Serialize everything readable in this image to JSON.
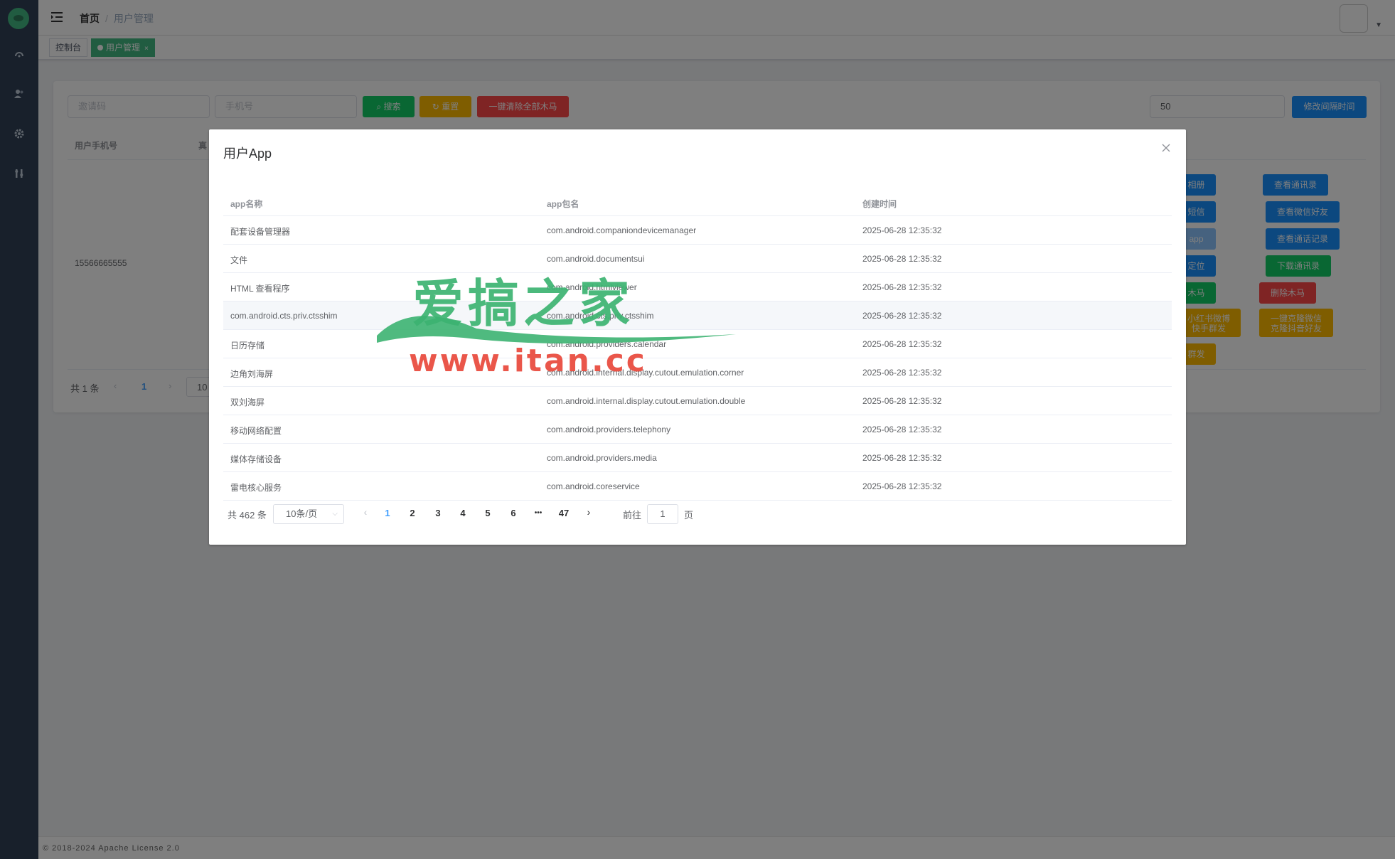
{
  "sidebar": {
    "icons": [
      "dashboard-icon",
      "users-icon",
      "gear-icon",
      "tools-icon"
    ]
  },
  "header": {
    "breadcrumb_home": "首页",
    "breadcrumb_separator": "/",
    "breadcrumb_current": "用户管理"
  },
  "tags": {
    "console": "控制台",
    "user_mgmt": "用户管理",
    "close": "×"
  },
  "filter": {
    "invite_placeholder": "邀请码",
    "phone_placeholder": "手机号",
    "search": "搜索",
    "reset": "重置",
    "clear_all": "一键清除全部木马",
    "interval_value": "50",
    "update_interval": "修改间隔时间"
  },
  "user_table": {
    "col_phone": "用户手机号",
    "col_name_partial": "真",
    "row_phone": "15566665555",
    "actions": {
      "album": "相册",
      "contacts": "查看通讯录",
      "sms": "短信",
      "wechat_friends": "查看微信好友",
      "app": "app",
      "call_log": "查看通话记录",
      "location": "定位",
      "download_contacts": "下载通讯录",
      "trojan": "木马",
      "delete_trojan": "删除木马",
      "xhs_line1": "小红书微博",
      "xhs_line2": "快手群发",
      "clone_line1": "一键克隆微信",
      "clone_line2": "克隆抖音好友",
      "mass": "群发"
    },
    "pager_total": "共 1 条",
    "pager_page": "1",
    "pager_size_partial": "10"
  },
  "dialog": {
    "title": "用户App",
    "close": "×",
    "columns": [
      "app名称",
      "app包名",
      "创建时间"
    ],
    "rows": [
      {
        "name": "配套设备管理器",
        "package": "com.android.companiondevicemanager",
        "time": "2025-06-28 12:35:32"
      },
      {
        "name": "文件",
        "package": "com.android.documentsui",
        "time": "2025-06-28 12:35:32"
      },
      {
        "name": "HTML 查看程序",
        "package": "com.android.htmlviewer",
        "time": "2025-06-28 12:35:32"
      },
      {
        "name": "com.android.cts.priv.ctsshim",
        "package": "com.android.cts.priv.ctsshim",
        "time": "2025-06-28 12:35:32"
      },
      {
        "name": "日历存储",
        "package": "com.android.providers.calendar",
        "time": "2025-06-28 12:35:32"
      },
      {
        "name": "边角刘海屏",
        "package": "com.android.internal.display.cutout.emulation.corner",
        "time": "2025-06-28 12:35:32"
      },
      {
        "name": "双刘海屏",
        "package": "com.android.internal.display.cutout.emulation.double",
        "time": "2025-06-28 12:35:32"
      },
      {
        "name": "移动网络配置",
        "package": "com.android.providers.telephony",
        "time": "2025-06-28 12:35:32"
      },
      {
        "name": "媒体存储设备",
        "package": "com.android.providers.media",
        "time": "2025-06-28 12:35:32"
      },
      {
        "name": "雷电核心服务",
        "package": "com.android.coreservice",
        "time": "2025-06-28 12:35:32"
      }
    ],
    "pager": {
      "total": "共 462 条",
      "page_size": "10条/页",
      "pages": [
        "1",
        "2",
        "3",
        "4",
        "5",
        "6",
        "•••",
        "47"
      ],
      "current": "1",
      "goto_label": "前往",
      "goto_value": "1",
      "goto_suffix": "页"
    }
  },
  "watermark": {
    "logo_text": "爱搞之家",
    "url": "www.itan.cc"
  },
  "footer": {
    "text": "© 2018-2024 Apache License 2.0"
  },
  "colors": {
    "sidebar": "#304156",
    "accent_green": "#42b983",
    "primary_blue": "#409eff",
    "success": "#13ce66",
    "warning": "#ffba00",
    "danger": "#ff4949",
    "action_blue": "#1890ff"
  }
}
